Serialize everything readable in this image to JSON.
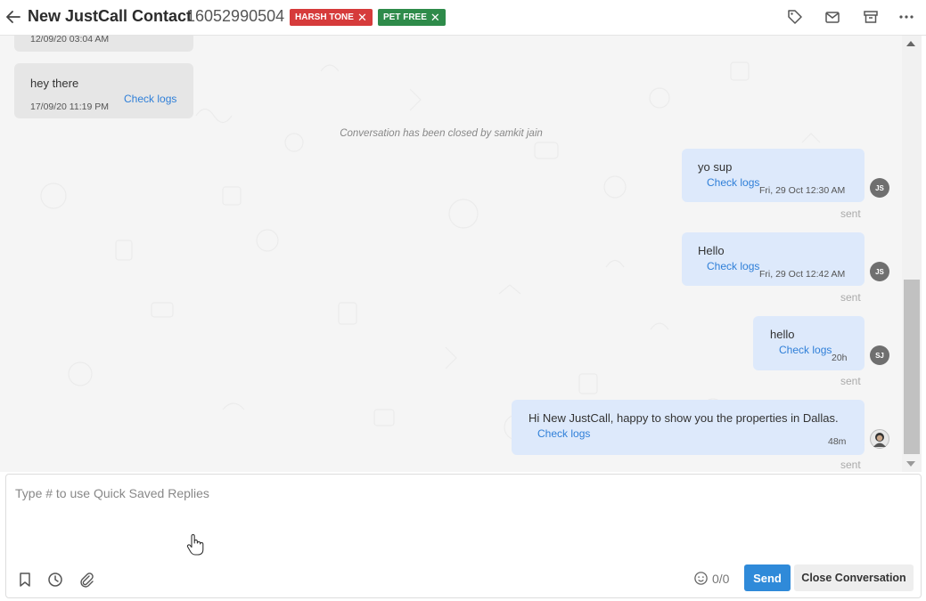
{
  "header": {
    "title": "New JustCall Contact",
    "phone": "16052990504",
    "tags": [
      {
        "label": "HARSH TONE",
        "color": "#d63b3b"
      },
      {
        "label": "PET FREE",
        "color": "#2e8b4a"
      }
    ],
    "icons": [
      "back-arrow-icon",
      "tag-icon",
      "mail-icon",
      "archive-icon",
      "more-icon"
    ]
  },
  "messages": {
    "partial_incoming_time": "12/09/20 03:04 AM",
    "incoming": {
      "text": "hey there",
      "time": "17/09/20 11:19 PM",
      "check": "Check logs"
    },
    "system_note": "Conversation has been closed by samkit jain",
    "outgoing": [
      {
        "text": "yo sup",
        "check": "Check logs",
        "time": "Fri, 29 Oct 12:30 AM",
        "avatar": "JS",
        "status": "sent"
      },
      {
        "text": "Hello",
        "check": "Check logs",
        "time": "Fri, 29 Oct 12:42 AM",
        "avatar": "JS",
        "status": "sent"
      },
      {
        "text": "hello",
        "check": "Check logs",
        "time": "20h",
        "avatar": "SJ",
        "status": "sent"
      },
      {
        "text": "Hi New JustCall, happy to show you the properties in Dallas.",
        "check": "Check logs",
        "time": "48m",
        "avatar": "photo",
        "status": "sent"
      }
    ]
  },
  "composer": {
    "placeholder": "Type # to use Quick Saved Replies",
    "value": "",
    "counter": "0/0",
    "send_label": "Send",
    "close_label": "Close Conversation",
    "icons": [
      "bookmark-icon",
      "clock-icon",
      "paperclip-icon",
      "emoji-icon"
    ]
  }
}
